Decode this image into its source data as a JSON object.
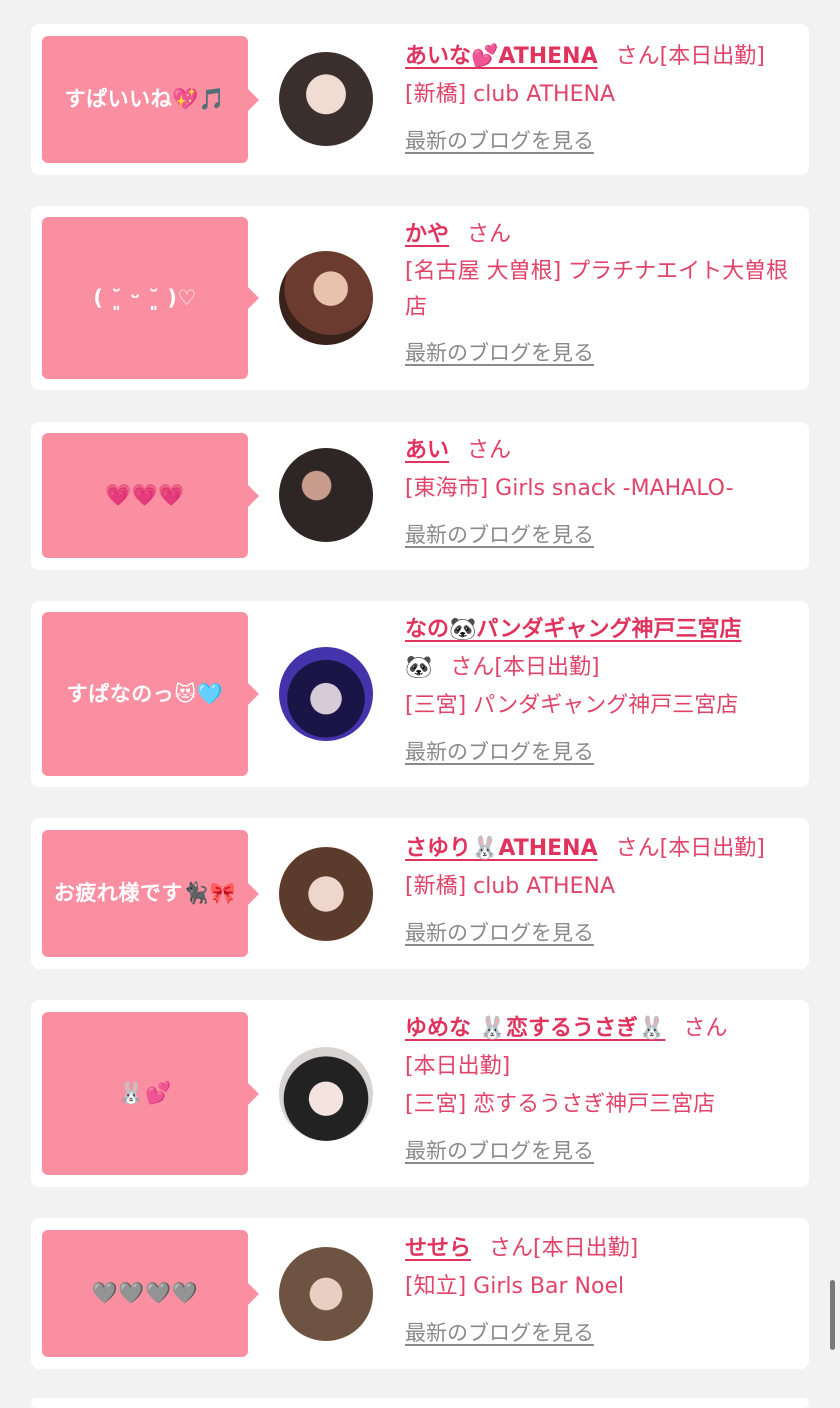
{
  "cards": [
    {
      "message": "すぱいいね💖🎵",
      "name": "あいな💕ATHENA",
      "san": "さん",
      "status": "[本日出勤]",
      "shop": "[新橋] club ATHENA",
      "blog": "最新のブログを見る"
    },
    {
      "message": "( ˘͈ ᵕ ˘͈ )♡",
      "name": "かや",
      "san": "さん",
      "status": "",
      "shop": "[名古屋 大曽根] プラチナエイト大曽根店",
      "blog": "最新のブログを見る"
    },
    {
      "message": "💗💗💗",
      "name": "あい",
      "san": "さん",
      "status": "",
      "shop": "[東海市] Girls snack -MAHALO-",
      "blog": "最新のブログを見る"
    },
    {
      "message": "すぱなのっ😻🩵",
      "name": "なの🐼パンダギャング神戸三宮店",
      "name_cont": "🐼",
      "san": "さん",
      "status": "[本日出勤]",
      "shop": "[三宮] パンダギャング神戸三宮店",
      "blog": "最新のブログを見る"
    },
    {
      "message": "お疲れ様です🐈‍⬛🎀",
      "name": "さゆり🐰ATHENA",
      "san": "さん",
      "status": "[本日出勤]",
      "shop": "[新橋] club ATHENA",
      "blog": "最新のブログを見る"
    },
    {
      "message": "🐰💕",
      "name": "ゆめな 🐰恋するうさぎ🐰",
      "san": "さん",
      "status": "[本日出勤]",
      "shop": "[三宮] 恋するうさぎ神戸三宮店",
      "blog": "最新のブログを見る"
    },
    {
      "message": "🩶🩶🩶🩶",
      "name": "せせら",
      "san": "さん",
      "status": "[本日出勤]",
      "shop": "[知立] Girls Bar Noel",
      "blog": "最新のブログを見る"
    }
  ]
}
